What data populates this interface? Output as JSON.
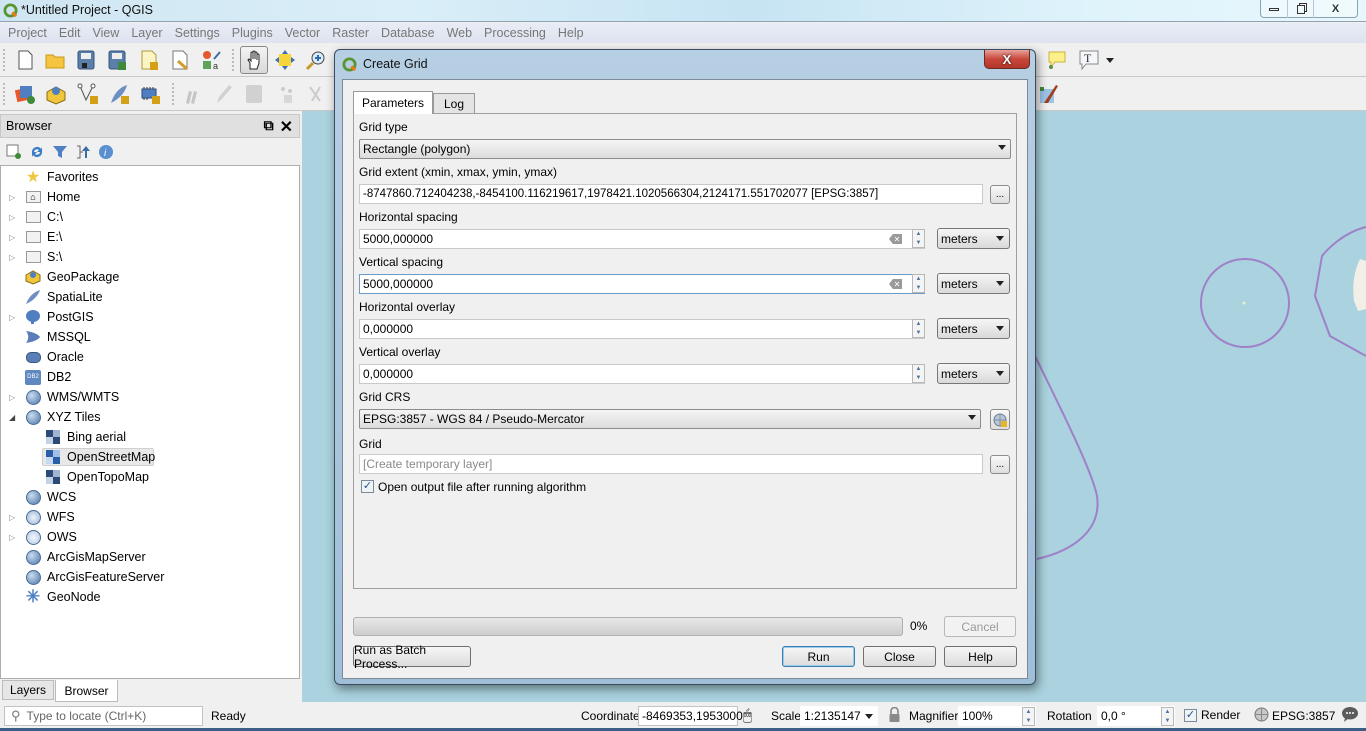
{
  "window": {
    "title": "*Untitled Project - QGIS",
    "controls": {
      "minimize": "▭",
      "maximize": "⧉",
      "close": "X"
    }
  },
  "menu": [
    "Project",
    "Edit",
    "View",
    "Layer",
    "Settings",
    "Plugins",
    "Vector",
    "Raster",
    "Database",
    "Web",
    "Processing",
    "Help"
  ],
  "browser": {
    "title": "Browser",
    "items": [
      {
        "label": "Favorites",
        "icon": "star-icon",
        "expandable": false,
        "level": 0
      },
      {
        "label": "Home",
        "icon": "home-folder-icon",
        "expandable": true,
        "level": 0
      },
      {
        "label": "C:\\",
        "icon": "folder-icon",
        "expandable": true,
        "level": 0
      },
      {
        "label": "E:\\",
        "icon": "folder-icon",
        "expandable": true,
        "level": 0
      },
      {
        "label": "S:\\",
        "icon": "folder-icon",
        "expandable": true,
        "level": 0
      },
      {
        "label": "GeoPackage",
        "icon": "geopackage-icon",
        "expandable": false,
        "level": 0
      },
      {
        "label": "SpatiaLite",
        "icon": "feather-icon",
        "expandable": false,
        "level": 0
      },
      {
        "label": "PostGIS",
        "icon": "elephant-icon",
        "expandable": true,
        "level": 0
      },
      {
        "label": "MSSQL",
        "icon": "mssql-icon",
        "expandable": false,
        "level": 0
      },
      {
        "label": "Oracle",
        "icon": "oracle-icon",
        "expandable": false,
        "level": 0
      },
      {
        "label": "DB2",
        "icon": "db2-icon",
        "expandable": false,
        "level": 0
      },
      {
        "label": "WMS/WMTS",
        "icon": "globe-icon",
        "expandable": true,
        "level": 0
      },
      {
        "label": "XYZ Tiles",
        "icon": "globe-icon",
        "expandable": true,
        "expanded": true,
        "level": 0
      },
      {
        "label": "Bing aerial",
        "icon": "xyz-tile-icon",
        "expandable": false,
        "level": 1
      },
      {
        "label": "OpenStreetMap",
        "icon": "xyz-tile-icon",
        "expandable": false,
        "level": 1,
        "selected": true
      },
      {
        "label": "OpenTopoMap",
        "icon": "xyz-tile-icon",
        "expandable": false,
        "level": 1
      },
      {
        "label": "WCS",
        "icon": "globe-icon",
        "expandable": false,
        "level": 0
      },
      {
        "label": "WFS",
        "icon": "globe-icon",
        "expandable": true,
        "level": 0
      },
      {
        "label": "OWS",
        "icon": "globe-icon",
        "expandable": true,
        "level": 0
      },
      {
        "label": "ArcGisMapServer",
        "icon": "globe-icon",
        "expandable": false,
        "level": 0
      },
      {
        "label": "ArcGisFeatureServer",
        "icon": "globe-icon",
        "expandable": false,
        "level": 0
      },
      {
        "label": "GeoNode",
        "icon": "geonode-icon",
        "expandable": false,
        "level": 0
      }
    ],
    "db2_badge": "DB2"
  },
  "panel_tabs": {
    "layers": "Layers",
    "browser": "Browser"
  },
  "dialog": {
    "title": "Create Grid",
    "close": "X",
    "tabs": {
      "parameters": "Parameters",
      "log": "Log"
    },
    "grid_type": {
      "label": "Grid type",
      "value": "Rectangle (polygon)"
    },
    "grid_extent": {
      "label": "Grid extent (xmin, xmax, ymin, ymax)",
      "value": "-8747860.712404238,-8454100.116219617,1978421.1020566304,2124171.551702077 [EPSG:3857]",
      "button": "..."
    },
    "h_spacing": {
      "label": "Horizontal spacing",
      "value": "5000,000000",
      "unit": "meters"
    },
    "v_spacing": {
      "label": "Vertical spacing",
      "value": "5000,000000",
      "unit": "meters"
    },
    "h_overlay": {
      "label": "Horizontal overlay",
      "value": "0,000000",
      "unit": "meters"
    },
    "v_overlay": {
      "label": "Vertical overlay",
      "value": "0,000000",
      "unit": "meters"
    },
    "grid_crs": {
      "label": "Grid CRS",
      "value": "EPSG:3857 - WGS 84 / Pseudo-Mercator"
    },
    "output": {
      "label": "Grid",
      "placeholder": "[Create temporary layer]",
      "button": "..."
    },
    "open_output": {
      "label": "Open output file after running algorithm",
      "checked": true
    },
    "progress": {
      "value": 0,
      "text": "0%"
    },
    "buttons": {
      "cancel": "Cancel",
      "batch": "Run as Batch Process...",
      "run": "Run",
      "close": "Close",
      "help": "Help"
    }
  },
  "statusbar": {
    "locate_placeholder": "Type to locate (Ctrl+K)",
    "status": "Ready",
    "coordinate_label": "Coordinate",
    "coordinate_value": "-8469353,1953000",
    "scale_label": "Scale",
    "scale_value": "1:2135147",
    "magnifier_label": "Magnifier",
    "magnifier_value": "100%",
    "rotation_label": "Rotation",
    "rotation_value": "0,0 °",
    "render_label": "Render",
    "render_checked": true,
    "crs": "EPSG:3857"
  },
  "colors": {
    "map_water": "#aad3df",
    "boundary": "#a080c8",
    "accent": "#3c7fb1"
  }
}
